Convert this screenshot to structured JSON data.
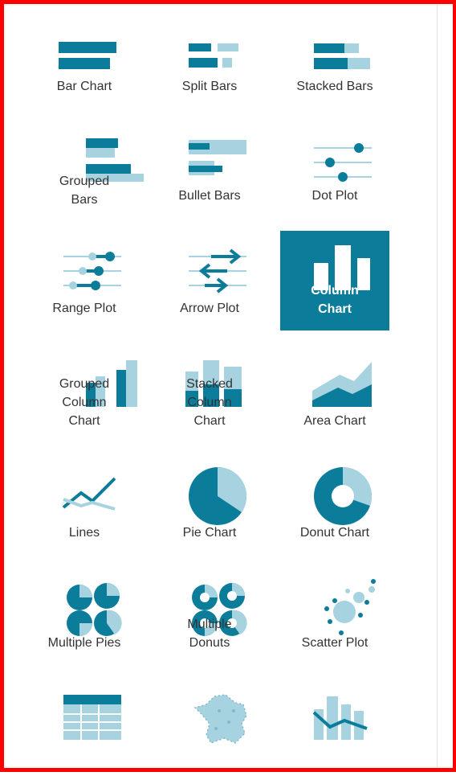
{
  "colors": {
    "dark": "#0b7d9a",
    "light": "#a6d3df",
    "selected_bg": "#0b7d9a",
    "frame": "#ff0000",
    "text": "#333333"
  },
  "charts": [
    {
      "label": "Bar Chart",
      "icon": "bar-chart-icon"
    },
    {
      "label": "Split Bars",
      "icon": "split-bars-icon"
    },
    {
      "label": "Stacked Bars",
      "icon": "stacked-bars-icon"
    },
    {
      "label_lines": [
        "Grouped",
        "Bars"
      ],
      "icon": "grouped-bars-icon"
    },
    {
      "label": "Bullet Bars",
      "icon": "bullet-bars-icon"
    },
    {
      "label": "Dot Plot",
      "icon": "dot-plot-icon"
    },
    {
      "label": "Range Plot",
      "icon": "range-plot-icon"
    },
    {
      "label": "Arrow Plot",
      "icon": "arrow-plot-icon"
    },
    {
      "label_lines": [
        "Column",
        "Chart"
      ],
      "icon": "column-chart-icon",
      "selected": true
    },
    {
      "label_lines": [
        "Grouped",
        "Column",
        "Chart"
      ],
      "icon": "grouped-column-chart-icon"
    },
    {
      "label_lines": [
        "Stacked",
        "Column",
        "Chart"
      ],
      "icon": "stacked-column-chart-icon"
    },
    {
      "label": "Area Chart",
      "icon": "area-chart-icon"
    },
    {
      "label": "Lines",
      "icon": "lines-icon"
    },
    {
      "label": "Pie Chart",
      "icon": "pie-chart-icon"
    },
    {
      "label": "Donut Chart",
      "icon": "donut-chart-icon"
    },
    {
      "label": "Multiple Pies",
      "icon": "multiple-pies-icon"
    },
    {
      "label_lines": [
        "Multiple",
        "Donuts"
      ],
      "icon": "multiple-donuts-icon"
    },
    {
      "label": "Scatter Plot",
      "icon": "scatter-plot-icon"
    },
    {
      "label": "",
      "icon": "table-icon"
    },
    {
      "label": "",
      "icon": "map-icon"
    },
    {
      "label": "",
      "icon": "column-line-icon"
    }
  ]
}
